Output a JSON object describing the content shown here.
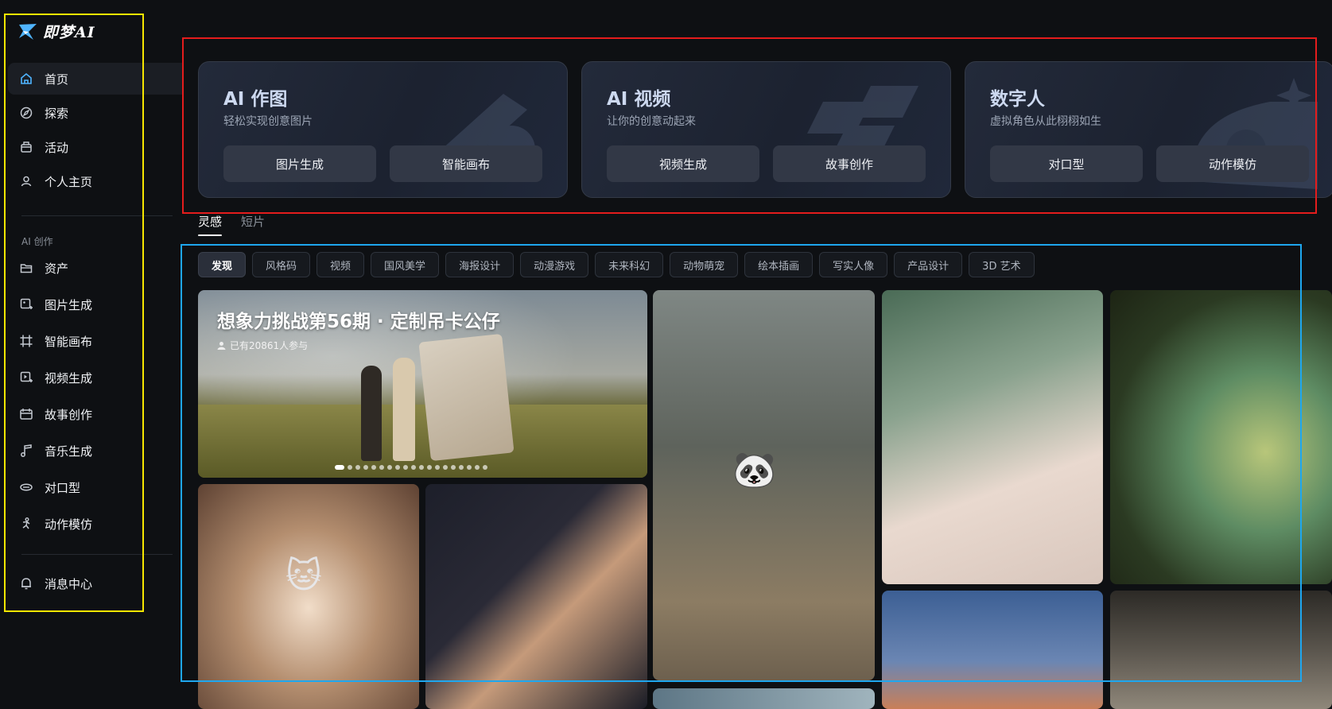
{
  "app": {
    "logo_text": "即梦AI"
  },
  "sidebar": {
    "items": [
      {
        "label": "首页",
        "icon": "home-icon"
      },
      {
        "label": "探索",
        "icon": "compass-icon"
      },
      {
        "label": "活动",
        "icon": "gift-icon"
      },
      {
        "label": "个人主页",
        "icon": "user-icon"
      }
    ],
    "section_label": "AI 创作",
    "tools": [
      {
        "label": "资产",
        "icon": "folder-icon"
      },
      {
        "label": "图片生成",
        "icon": "image-gen-icon"
      },
      {
        "label": "智能画布",
        "icon": "canvas-icon"
      },
      {
        "label": "视频生成",
        "icon": "video-gen-icon"
      },
      {
        "label": "故事创作",
        "icon": "story-icon"
      },
      {
        "label": "音乐生成",
        "icon": "music-icon"
      },
      {
        "label": "对口型",
        "icon": "lipsync-icon"
      },
      {
        "label": "动作模仿",
        "icon": "motion-icon"
      }
    ],
    "bottom": {
      "label": "消息中心",
      "icon": "bell-icon"
    }
  },
  "feature_cards": [
    {
      "title": "AI 作图",
      "subtitle": "轻松实现创意图片",
      "buttons": [
        "图片生成",
        "智能画布"
      ]
    },
    {
      "title": "AI 视频",
      "subtitle": "让你的创意动起来",
      "buttons": [
        "视频生成",
        "故事创作"
      ]
    },
    {
      "title": "数字人",
      "subtitle": "虚拟角色从此栩栩如生",
      "buttons": [
        "对口型",
        "动作模仿"
      ]
    }
  ],
  "tabs": [
    "灵感",
    "短片"
  ],
  "chips": [
    "发现",
    "风格码",
    "视频",
    "国风美学",
    "海报设计",
    "动漫游戏",
    "未来科幻",
    "动物萌宠",
    "绘本插画",
    "写实人像",
    "产品设计",
    "3D 艺术"
  ],
  "banner": {
    "title": "想象力挑战第56期 · 定制吊卡公仔",
    "participants": "已有20861人参与",
    "slide_count": 19,
    "active_slide": 1
  },
  "colors": {
    "background": "#0e1013",
    "card_bg": "#1c2230",
    "annotation_yellow": "#f6e600",
    "annotation_red": "#e41c1c",
    "annotation_blue": "#1ea7ef"
  }
}
